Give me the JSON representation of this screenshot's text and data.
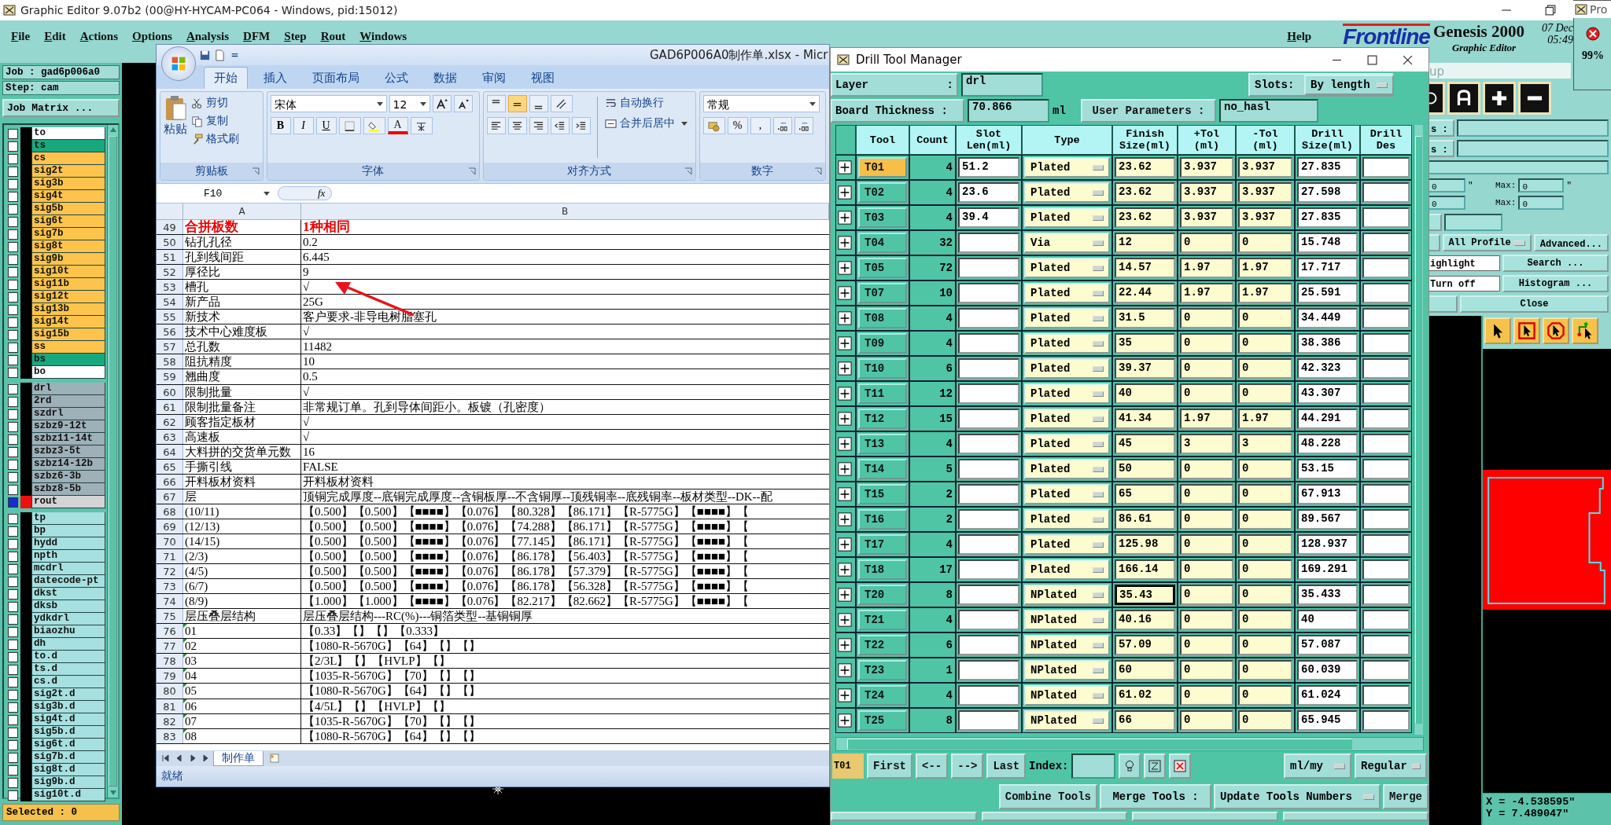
{
  "main_window": {
    "title": "Graphic Editor 9.07b2 (00@HY-HYCAM-PC064 - Windows, pid:15012)",
    "menu": [
      "File",
      "Edit",
      "Actions",
      "Options",
      "Analysis",
      "DFM",
      "Step",
      "Rout",
      "Windows"
    ],
    "help": "Help",
    "logo": "Frontline",
    "product": "Genesis 2000",
    "subtitle": "Graphic Editor",
    "date": "07 Dec",
    "time": "05:49"
  },
  "job_panel": {
    "job": "Job : gad6p006a0",
    "step": "Step: cam",
    "matrix_button": "Job Matrix ...",
    "selected_count": "Selected : 0",
    "layer_groups": [
      [
        {
          "name": "to",
          "color": "#ffffff",
          "work": false
        },
        {
          "name": "ts",
          "color": "#17a87e",
          "work": false
        },
        {
          "name": "cs",
          "color": "#fcc44c",
          "work": false
        },
        {
          "name": "sig2t",
          "color": "#fcc44c",
          "work": false
        },
        {
          "name": "sig3b",
          "color": "#fcc44c",
          "work": false
        },
        {
          "name": "sig4t",
          "color": "#fcc44c",
          "work": false
        },
        {
          "name": "sig5b",
          "color": "#fcc44c",
          "work": false
        },
        {
          "name": "sig6t",
          "color": "#fcc44c",
          "work": false
        },
        {
          "name": "sig7b",
          "color": "#fcc44c",
          "work": false
        },
        {
          "name": "sig8t",
          "color": "#fcc44c",
          "work": false
        },
        {
          "name": "sig9b",
          "color": "#fcc44c",
          "work": false
        },
        {
          "name": "sig10t",
          "color": "#fcc44c",
          "work": false
        },
        {
          "name": "sig11b",
          "color": "#fcc44c",
          "work": false
        },
        {
          "name": "sig12t",
          "color": "#fcc44c",
          "work": false
        },
        {
          "name": "sig13b",
          "color": "#fcc44c",
          "work": false
        },
        {
          "name": "sig14t",
          "color": "#fcc44c",
          "work": false
        },
        {
          "name": "sig15b",
          "color": "#fcc44c",
          "work": false
        },
        {
          "name": "ss",
          "color": "#fcc44c",
          "work": false
        },
        {
          "name": "bs",
          "color": "#17a87e",
          "work": false
        },
        {
          "name": "bo",
          "color": "#ffffff",
          "work": false
        }
      ],
      [
        {
          "name": "drl",
          "color": "#9eb0b8",
          "work": false
        },
        {
          "name": "2rd",
          "color": "#9eb0b8",
          "work": false
        },
        {
          "name": "szdrl",
          "color": "#9eb0b8",
          "work": false
        },
        {
          "name": "szbz9-12t",
          "color": "#9eb0b8",
          "work": false
        },
        {
          "name": "szbz11-14t",
          "color": "#9eb0b8",
          "work": false
        },
        {
          "name": "szbz3-5t",
          "color": "#9eb0b8",
          "work": false
        },
        {
          "name": "szbz14-12b",
          "color": "#9eb0b8",
          "work": false
        },
        {
          "name": "szbz6-3b",
          "color": "#9eb0b8",
          "work": false
        },
        {
          "name": "szbz8-5b",
          "color": "#9eb0b8",
          "work": false
        },
        {
          "name": "rout",
          "color": "#d4d4d4",
          "work": true
        }
      ],
      [
        {
          "name": "tp",
          "color": "#a6e0e0",
          "work": false
        },
        {
          "name": "bp",
          "color": "#a6e0e0",
          "work": false
        },
        {
          "name": "hydd",
          "color": "#a6e0e0",
          "work": false
        },
        {
          "name": "npth",
          "color": "#a6e0e0",
          "work": false
        },
        {
          "name": "mcdrl",
          "color": "#a6e0e0",
          "work": false
        },
        {
          "name": "datecode-pt",
          "color": "#a6e0e0",
          "work": false
        },
        {
          "name": "dkst",
          "color": "#a6e0e0",
          "work": false
        },
        {
          "name": "dksb",
          "color": "#a6e0e0",
          "work": false
        },
        {
          "name": "ydkdrl",
          "color": "#a6e0e0",
          "work": false
        },
        {
          "name": "biaozhu",
          "color": "#a6e0e0",
          "work": false
        },
        {
          "name": "dh",
          "color": "#a6e0e0",
          "work": false
        },
        {
          "name": "to.d",
          "color": "#a6e0e0",
          "work": false
        },
        {
          "name": "ts.d",
          "color": "#a6e0e0",
          "work": false
        },
        {
          "name": "cs.d",
          "color": "#a6e0e0",
          "work": false
        },
        {
          "name": "sig2t.d",
          "color": "#a6e0e0",
          "work": false
        },
        {
          "name": "sig3b.d",
          "color": "#a6e0e0",
          "work": false
        },
        {
          "name": "sig4t.d",
          "color": "#a6e0e0",
          "work": false
        },
        {
          "name": "sig5b.d",
          "color": "#a6e0e0",
          "work": false
        },
        {
          "name": "sig6t.d",
          "color": "#a6e0e0",
          "work": false
        },
        {
          "name": "sig7b.d",
          "color": "#a6e0e0",
          "work": false
        },
        {
          "name": "sig8t.d",
          "color": "#a6e0e0",
          "work": false
        },
        {
          "name": "sig9b.d",
          "color": "#a6e0e0",
          "work": false
        },
        {
          "name": "sig10t.d",
          "color": "#a6e0e0",
          "work": false
        }
      ]
    ]
  },
  "excel": {
    "title": "GAD6P006A0制作单.xlsx - Micr",
    "tabs": [
      {
        "label": "开始",
        "selected": true
      },
      {
        "label": "插入",
        "selected": false
      },
      {
        "label": "页面布局",
        "selected": false
      },
      {
        "label": "公式",
        "selected": false
      },
      {
        "label": "数据",
        "selected": false
      },
      {
        "label": "审阅",
        "selected": false
      },
      {
        "label": "视图",
        "selected": false
      }
    ],
    "clipboard": {
      "paste": "粘贴",
      "cut": "剪切",
      "copy": "复制",
      "format_painter": "格式刷",
      "group": "剪贴板"
    },
    "font": {
      "name": "宋体",
      "size": "12",
      "bold": "B",
      "italic": "I",
      "underline": "U",
      "color_letter": "A",
      "group": "字体"
    },
    "alignment": {
      "vertical": [
        {
          "selected": false
        },
        {
          "selected": true
        },
        {
          "selected": false
        }
      ],
      "wrap": "自动换行",
      "merge": "合并后居中",
      "group": "对齐方式"
    },
    "number": {
      "format": "常规",
      "percent": "%",
      "comma": ",",
      "group": "数字"
    },
    "name_box": "F10",
    "fx": "fx",
    "columns": [
      "A",
      "B"
    ],
    "rows": [
      {
        "n": "49",
        "a": "合拼板数",
        "b": "1种相同",
        "emphasis": true,
        "text_flag": false
      },
      {
        "n": "50",
        "a": "钻孔孔径",
        "b": "0.2",
        "emphasis": false,
        "text_flag": false
      },
      {
        "n": "51",
        "a": "孔到线间距",
        "b": "6.445",
        "emphasis": false,
        "text_flag": false
      },
      {
        "n": "52",
        "a": "厚径比",
        "b": "9",
        "emphasis": false,
        "text_flag": false
      },
      {
        "n": "53",
        "a": "槽孔",
        "b": "√",
        "emphasis": false,
        "text_flag": false
      },
      {
        "n": "54",
        "a": "新产品",
        "b": "25G",
        "emphasis": false,
        "text_flag": false
      },
      {
        "n": "55",
        "a": "新技术",
        "b": "客户要求-非导电树脂塞孔",
        "emphasis": false,
        "text_flag": false
      },
      {
        "n": "56",
        "a": "技术中心难度板",
        "b": "√",
        "emphasis": false,
        "text_flag": false
      },
      {
        "n": "57",
        "a": "总孔数",
        "b": "11482",
        "emphasis": false,
        "text_flag": false
      },
      {
        "n": "58",
        "a": "阻抗精度",
        "b": "10",
        "emphasis": false,
        "text_flag": false
      },
      {
        "n": "59",
        "a": "翘曲度",
        "b": "0.5",
        "emphasis": false,
        "text_flag": false
      },
      {
        "n": "60",
        "a": "限制批量",
        "b": "√",
        "emphasis": false,
        "text_flag": false
      },
      {
        "n": "61",
        "a": "限制批量备注",
        "b": "非常规订单。孔到导体间距小。板镀（孔密度）",
        "emphasis": false,
        "text_flag": false
      },
      {
        "n": "62",
        "a": "顾客指定板材",
        "b": "√",
        "emphasis": false,
        "text_flag": false
      },
      {
        "n": "63",
        "a": "高速板",
        "b": "√",
        "emphasis": false,
        "text_flag": false
      },
      {
        "n": "64",
        "a": "大料拼的交货单元数",
        "b": "16",
        "emphasis": false,
        "text_flag": false
      },
      {
        "n": "65",
        "a": "手撕引线",
        "b": "FALSE",
        "emphasis": false,
        "text_flag": false
      },
      {
        "n": "66",
        "a": "开料板材资料",
        "b": "开料板材资料",
        "emphasis": false,
        "text_flag": false
      },
      {
        "n": "67",
        "a": "层",
        "b": "顶铜完成厚度--底铜完成厚度--含铜板厚--不含铜厚--顶残铜率--底残铜率--板材类型--DK--配",
        "emphasis": false,
        "text_flag": false
      },
      {
        "n": "68",
        "a": "(10/11)",
        "b": "【0.500】【0.500】【■■■■】【0.076】【80.328】【86.171】【R-5775G】【■■■■】【",
        "emphasis": false,
        "text_flag": false
      },
      {
        "n": "69",
        "a": "(12/13)",
        "b": "【0.500】【0.500】【■■■■】【0.076】【74.288】【86.171】【R-5775G】【■■■■】【",
        "emphasis": false,
        "text_flag": false
      },
      {
        "n": "70",
        "a": "(14/15)",
        "b": "【0.500】【0.500】【■■■■】【0.076】【77.145】【86.171】【R-5775G】【■■■■】【",
        "emphasis": false,
        "text_flag": false
      },
      {
        "n": "71",
        "a": "(2/3)",
        "b": "【0.500】【0.500】【■■■■】【0.076】【86.178】【56.403】【R-5775G】【■■■■】【",
        "emphasis": false,
        "text_flag": false
      },
      {
        "n": "72",
        "a": "(4/5)",
        "b": "【0.500】【0.500】【■■■■】【0.076】【86.178】【57.379】【R-5775G】【■■■■】【",
        "emphasis": false,
        "text_flag": false
      },
      {
        "n": "73",
        "a": "(6/7)",
        "b": "【0.500】【0.500】【■■■■】【0.076】【86.178】【56.328】【R-5775G】【■■■■】【",
        "emphasis": false,
        "text_flag": false
      },
      {
        "n": "74",
        "a": "(8/9)",
        "b": "【1.000】【1.000】【■■■■】【0.076】【82.217】【82.662】【R-5775G】【■■■■】【",
        "emphasis": false,
        "text_flag": false
      },
      {
        "n": "75",
        "a": "层压叠层结构",
        "b": "层压叠层结构---RC(%)---铜箔类型--基铜铜厚",
        "emphasis": false,
        "text_flag": false
      },
      {
        "n": "76",
        "a": "01",
        "b": "【0.33】【】【】【0.333】",
        "emphasis": false,
        "text_flag": true
      },
      {
        "n": "77",
        "a": "02",
        "b": "【1080-R-5670G】【64】【】【】",
        "emphasis": false,
        "text_flag": true
      },
      {
        "n": "78",
        "a": "03",
        "b": "【2/3L】【】【HVLP】【】",
        "emphasis": false,
        "text_flag": true
      },
      {
        "n": "79",
        "a": "04",
        "b": "【1035-R-5670G】【70】【】【】",
        "emphasis": false,
        "text_flag": true
      },
      {
        "n": "80",
        "a": "05",
        "b": "【1080-R-5670G】【64】【】【】",
        "emphasis": false,
        "text_flag": true
      },
      {
        "n": "81",
        "a": "06",
        "b": "【4/5L】【】【HVLP】【】",
        "emphasis": false,
        "text_flag": true
      },
      {
        "n": "82",
        "a": "07",
        "b": "【1035-R-5670G】【70】【】【】",
        "emphasis": false,
        "text_flag": true
      },
      {
        "n": "83",
        "a": "08",
        "b": "【1080-R-5670G】【64】【】【】",
        "emphasis": false,
        "text_flag": true
      }
    ],
    "sheet_tab": "制作单",
    "status": "就绪"
  },
  "drill_manager": {
    "title": "Drill Tool Manager",
    "layer_label": "Layer",
    "layer_colon": ":",
    "layer": "drl",
    "slots_label": "Slots:",
    "slots": "By length",
    "thickness_label": "Board Thickness :",
    "thickness": "70.866",
    "thickness_unit": "ml",
    "user_params_label": "User Parameters :",
    "user_params": "no_hasl",
    "columns": [
      "Tool",
      "Count",
      "Slot Len(ml)",
      "Type",
      "Finish Size(ml)",
      "+Tol (ml)",
      "-Tol (ml)",
      "Drill Size(ml)",
      "Drill Des"
    ],
    "tools": [
      {
        "tool": "T01",
        "count": "4",
        "slot_len": "51.2",
        "type": "Plated",
        "finish": "23.62",
        "plus_tol": "3.937",
        "minus_tol": "3.937",
        "drill_size": "27.835",
        "selected": true,
        "editing": false
      },
      {
        "tool": "T02",
        "count": "4",
        "slot_len": "23.6",
        "type": "Plated",
        "finish": "23.62",
        "plus_tol": "3.937",
        "minus_tol": "3.937",
        "drill_size": "27.598",
        "selected": false,
        "editing": false
      },
      {
        "tool": "T03",
        "count": "4",
        "slot_len": "39.4",
        "type": "Plated",
        "finish": "23.62",
        "plus_tol": "3.937",
        "minus_tol": "3.937",
        "drill_size": "27.835",
        "selected": false,
        "editing": false
      },
      {
        "tool": "T04",
        "count": "32",
        "type": "Via",
        "finish": "12",
        "plus_tol": "0",
        "minus_tol": "0",
        "drill_size": "15.748",
        "selected": false,
        "editing": false
      },
      {
        "tool": "T05",
        "count": "72",
        "type": "Plated",
        "finish": "14.57",
        "plus_tol": "1.97",
        "minus_tol": "1.97",
        "drill_size": "17.717",
        "selected": false,
        "editing": false
      },
      {
        "tool": "T07",
        "count": "10",
        "type": "Plated",
        "finish": "22.44",
        "plus_tol": "1.97",
        "minus_tol": "1.97",
        "drill_size": "25.591",
        "selected": false,
        "editing": false
      },
      {
        "tool": "T08",
        "count": "4",
        "type": "Plated",
        "finish": "31.5",
        "plus_tol": "0",
        "minus_tol": "0",
        "drill_size": "34.449",
        "selected": false,
        "editing": false
      },
      {
        "tool": "T09",
        "count": "4",
        "type": "Plated",
        "finish": "35",
        "plus_tol": "0",
        "minus_tol": "0",
        "drill_size": "38.386",
        "selected": false,
        "editing": false
      },
      {
        "tool": "T10",
        "count": "6",
        "type": "Plated",
        "finish": "39.37",
        "plus_tol": "0",
        "minus_tol": "0",
        "drill_size": "42.323",
        "selected": false,
        "editing": false
      },
      {
        "tool": "T11",
        "count": "12",
        "type": "Plated",
        "finish": "40",
        "plus_tol": "0",
        "minus_tol": "0",
        "drill_size": "43.307",
        "selected": false,
        "editing": false
      },
      {
        "tool": "T12",
        "count": "15",
        "type": "Plated",
        "finish": "41.34",
        "plus_tol": "1.97",
        "minus_tol": "1.97",
        "drill_size": "44.291",
        "selected": false,
        "editing": false
      },
      {
        "tool": "T13",
        "count": "4",
        "type": "Plated",
        "finish": "45",
        "plus_tol": "3",
        "minus_tol": "3",
        "drill_size": "48.228",
        "selected": false,
        "editing": false
      },
      {
        "tool": "T14",
        "count": "5",
        "type": "Plated",
        "finish": "50",
        "plus_tol": "0",
        "minus_tol": "0",
        "drill_size": "53.15",
        "selected": false,
        "editing": false
      },
      {
        "tool": "T15",
        "count": "2",
        "type": "Plated",
        "finish": "65",
        "plus_tol": "0",
        "minus_tol": "0",
        "drill_size": "67.913",
        "selected": false,
        "editing": false
      },
      {
        "tool": "T16",
        "count": "2",
        "type": "Plated",
        "finish": "86.61",
        "plus_tol": "0",
        "minus_tol": "0",
        "drill_size": "89.567",
        "selected": false,
        "editing": false
      },
      {
        "tool": "T17",
        "count": "4",
        "type": "Plated",
        "finish": "125.98",
        "plus_tol": "0",
        "minus_tol": "0",
        "drill_size": "128.937",
        "selected": false,
        "editing": false
      },
      {
        "tool": "T18",
        "count": "17",
        "type": "Plated",
        "finish": "166.14",
        "plus_tol": "0",
        "minus_tol": "0",
        "drill_size": "169.291",
        "selected": false,
        "editing": false
      },
      {
        "tool": "T20",
        "count": "8",
        "type": "NPlated",
        "finish": "35.43",
        "plus_tol": "0",
        "minus_tol": "0",
        "drill_size": "35.433",
        "selected": false,
        "editing": true
      },
      {
        "tool": "T21",
        "count": "4",
        "type": "NPlated",
        "finish": "40.16",
        "plus_tol": "0",
        "minus_tol": "0",
        "drill_size": "40",
        "selected": false,
        "editing": false
      },
      {
        "tool": "T22",
        "count": "6",
        "type": "NPlated",
        "finish": "57.09",
        "plus_tol": "0",
        "minus_tol": "0",
        "drill_size": "57.087",
        "selected": false,
        "editing": false
      },
      {
        "tool": "T23",
        "count": "1",
        "type": "NPlated",
        "finish": "60",
        "plus_tol": "0",
        "minus_tol": "0",
        "drill_size": "60.039",
        "selected": false,
        "editing": false
      },
      {
        "tool": "T24",
        "count": "4",
        "type": "NPlated",
        "finish": "61.02",
        "plus_tol": "0",
        "minus_tol": "0",
        "drill_size": "61.024",
        "selected": false,
        "editing": false
      },
      {
        "tool": "T25",
        "count": "8",
        "type": "NPlated",
        "finish": "66",
        "plus_tol": "0",
        "minus_tol": "0",
        "drill_size": "65.945",
        "selected": false,
        "editing": false
      }
    ],
    "current_tool": "T01",
    "nav": [
      "First",
      "<--",
      "-->",
      "Last"
    ],
    "index_label": "Index:",
    "units": "ml/my",
    "mode": "Regular",
    "combine": "Combine Tools",
    "merge_label": "Merge Tools :",
    "merge_mode": "Update Tools Numbers",
    "merge": "Merge"
  },
  "right_panel": {
    "group_hint": "up",
    "labels": [
      "s :",
      "s :"
    ],
    "ranges": [
      {
        "min": "0",
        "max_label": "Max:",
        "max": "0",
        "unit": "\""
      },
      {
        "min": "0",
        "max_label": "Max:",
        "max": "0"
      }
    ],
    "profile": "All Profile",
    "advanced": "Advanced...",
    "highlight": "ighlight",
    "search": "Search ...",
    "turn_off": "Turn off",
    "histogram": "Histogram ...",
    "close": "Close",
    "x": "X = -4.538595\"",
    "y": "Y = 7.489047\""
  },
  "progress_window": {
    "title": "Pro",
    "percent": "99%"
  }
}
